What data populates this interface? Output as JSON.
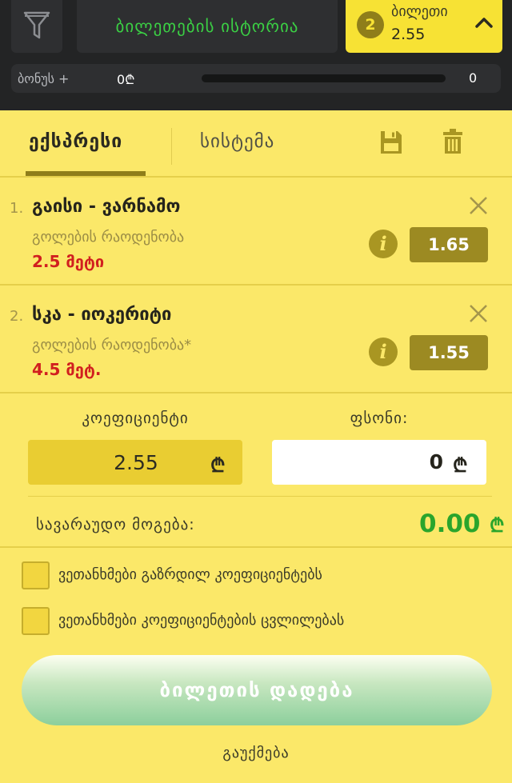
{
  "header": {
    "history_label": "ბილეთების ისტორია",
    "ticket_count": "2",
    "ticket_label": "ბილეთი",
    "ticket_total_odds": "2.55",
    "bonus": {
      "label": "ბონუს +",
      "value": "0₾",
      "progress": 0,
      "max": "0"
    }
  },
  "tabs": {
    "express": "ექსპრესი",
    "system": "სისტემა"
  },
  "bets": [
    {
      "index": "1.",
      "match": "გაისი - ვარნამო",
      "market": "გოლების რაოდენობა",
      "selection": "2.5 მეტი",
      "odds": "1.65"
    },
    {
      "index": "2.",
      "match": "სკა - იოკერიტი",
      "market": "გოლების რაოდენობა*",
      "selection": "4.5 მეტ.",
      "odds": "1.55"
    }
  ],
  "summary": {
    "coef_label": "კოეფიციენტი",
    "coef_value": "2.55",
    "stake_label": "ფსონი:",
    "stake_value": "0",
    "currency": "₾",
    "win_label": "სავარაუდო მოგება:",
    "win_value": "0.00"
  },
  "options": {
    "accept_higher": "ვეთანხმები გაზრდილ კოეფიციენტებს",
    "accept_changes": "ვეთანხმები კოეფიციენტების ცვლილებას"
  },
  "actions": {
    "place_bet": "ბილეთის დადება",
    "cancel": "გაუქმება"
  },
  "colors": {
    "panel": "#fbe869",
    "header": "#232425",
    "accent_dark": "#9c8a22",
    "win_green": "#2aa52c",
    "selection_red": "#d11f1f"
  }
}
